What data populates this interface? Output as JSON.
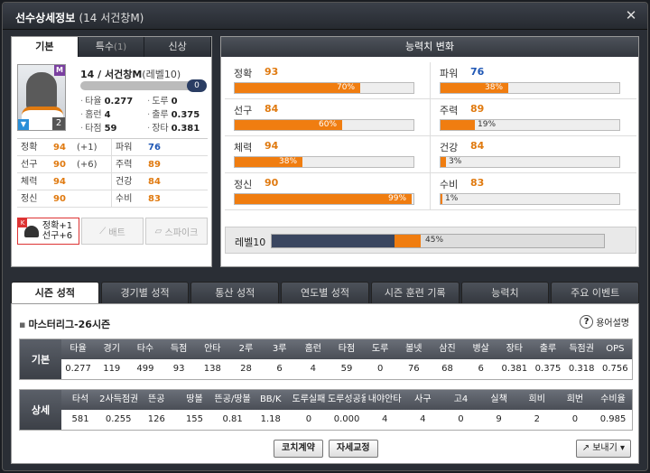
{
  "window": {
    "title": "선수상세정보",
    "subtitle": "(14 서건창M)",
    "close": "✕"
  },
  "left": {
    "tabs": [
      {
        "label": "기본",
        "count": ""
      },
      {
        "label": "특수",
        "count": "(1)"
      },
      {
        "label": "신상",
        "count": ""
      }
    ],
    "card": {
      "badge_top": "M",
      "badge_bottom": "▼",
      "badge_num": "2"
    },
    "player": {
      "name": "14 / 서건창M",
      "level": "(레벨10)",
      "exp_knob": "0"
    },
    "mini_stats": [
      [
        {
          "k": "타율",
          "v": "0.277"
        },
        {
          "k": "도루",
          "v": "0"
        }
      ],
      [
        {
          "k": "홈런",
          "v": "4"
        },
        {
          "k": "출루",
          "v": "0.375"
        }
      ],
      [
        {
          "k": "타점",
          "v": "59"
        },
        {
          "k": "장타",
          "v": "0.381"
        }
      ]
    ],
    "stats": [
      [
        {
          "k": "정확",
          "v": "94",
          "b": "(+1)"
        },
        {
          "k": "파워",
          "v": "76",
          "b": ""
        }
      ],
      [
        {
          "k": "선구",
          "v": "90",
          "b": "(+6)"
        },
        {
          "k": "주력",
          "v": "89",
          "b": ""
        }
      ],
      [
        {
          "k": "체력",
          "v": "94",
          "b": ""
        },
        {
          "k": "건강",
          "v": "84",
          "b": ""
        }
      ],
      [
        {
          "k": "정신",
          "v": "90",
          "b": ""
        },
        {
          "k": "수비",
          "v": "83",
          "b": ""
        }
      ]
    ],
    "equip": {
      "k_badge": "K",
      "helmet_line1": "정확+1",
      "helmet_line2": "선구+6",
      "bat": "배트",
      "spike": "스파이크"
    }
  },
  "abilities": {
    "header": "능력치 변화",
    "items": [
      {
        "k": "정확",
        "v": "93",
        "pct_label": "70%",
        "fill": 0.7,
        "color": "orange"
      },
      {
        "k": "파워",
        "v": "76",
        "pct_label": "38%",
        "fill": 0.38,
        "color": "blue"
      },
      {
        "k": "선구",
        "v": "84",
        "pct_label": "60%",
        "fill": 0.6,
        "color": "orange"
      },
      {
        "k": "주력",
        "v": "89",
        "pct_label": "19%",
        "fill": 0.19,
        "color": "orange"
      },
      {
        "k": "체력",
        "v": "94",
        "pct_label": "38%",
        "fill": 0.38,
        "color": "orange"
      },
      {
        "k": "건강",
        "v": "84",
        "pct_label": "3%",
        "fill": 0.03,
        "color": "orange"
      },
      {
        "k": "정신",
        "v": "90",
        "pct_label": "99%",
        "fill": 0.99,
        "color": "orange"
      },
      {
        "k": "수비",
        "v": "83",
        "pct_label": "1%",
        "fill": 0.01,
        "color": "orange"
      }
    ],
    "level": {
      "label": "레벨10",
      "pct_label": "45%",
      "fill": 0.45,
      "base": 0.37
    }
  },
  "bottom_tabs": [
    "시즌 성적",
    "경기별 성적",
    "통산 성적",
    "연도별 성적",
    "시즌 훈련 기록",
    "능력치",
    "주요 이벤트"
  ],
  "season": {
    "title": "마스터리그-26시즌",
    "help": "용어설명"
  },
  "basic": {
    "label": "기본",
    "headers": [
      "타율",
      "경기",
      "타수",
      "득점",
      "안타",
      "2루",
      "3루",
      "홈런",
      "타점",
      "도루",
      "볼넷",
      "삼진",
      "병살",
      "장타",
      "출루",
      "득점권",
      "OPS"
    ],
    "values": [
      "0.277",
      "119",
      "499",
      "93",
      "138",
      "28",
      "6",
      "4",
      "59",
      "0",
      "76",
      "68",
      "6",
      "0.381",
      "0.375",
      "0.318",
      "0.756"
    ]
  },
  "detail": {
    "label": "상세",
    "headers": [
      "타석",
      "2사득점권",
      "뜬공",
      "땅볼",
      "뜬공/땅볼",
      "BB/K",
      "도루실패",
      "도루성공율",
      "내야안타",
      "사구",
      "고4",
      "실책",
      "희비",
      "희번",
      "수비율"
    ],
    "values": [
      "581",
      "0.255",
      "126",
      "155",
      "0.81",
      "1.18",
      "0",
      "0.000",
      "4",
      "4",
      "0",
      "9",
      "2",
      "0",
      "0.985"
    ]
  },
  "buttons": {
    "coach": "코치계약",
    "posture": "자세교정",
    "send": "보내기"
  }
}
